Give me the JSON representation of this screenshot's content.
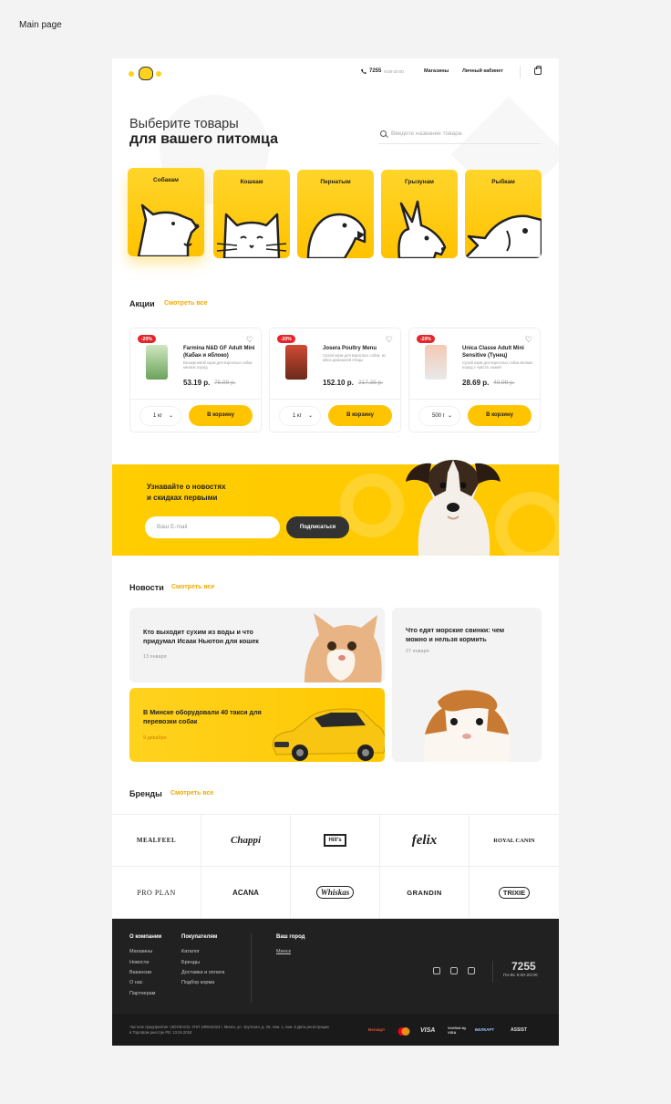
{
  "caption": "Main page",
  "header": {
    "phone": "7255",
    "hours": "9:00-20:00",
    "nav": [
      "Магазины",
      "Личный кабинет"
    ]
  },
  "hero": {
    "title_light": "Выберите товары",
    "title_bold": "для вашего питомца",
    "search_placeholder": "Введите название товара"
  },
  "categories": [
    "Собакам",
    "Кошкам",
    "Пернатым",
    "Грызунам",
    "Рыбкам"
  ],
  "promo": {
    "title": "Акции",
    "link": "Смотреть все",
    "products": [
      {
        "badge": "-20%",
        "name": "Farmina N&D GF Adult Mini (Кабан и яблоко)",
        "desc": "Беззерновой корм для взрослых собак мелких пород",
        "price": "53.19 р.",
        "old_price": "75.99 р.",
        "qty": "1 кг",
        "button": "В корзину"
      },
      {
        "badge": "-20%",
        "name": "Josera Poultry Menu",
        "desc": "Сухой корм для взрослых собак, из мяса домашней птицы",
        "price": "152.10 р.",
        "old_price": "217.35 р.",
        "qty": "1 кг",
        "button": "В корзину"
      },
      {
        "badge": "-20%",
        "name": "Unica Classe Adult Mini Sensitive (Тунец)",
        "desc": "Сухой корм для взрослых собак мелких пород с чувств. кожей",
        "price": "28.69 р.",
        "old_price": "40.99 р.",
        "qty": "500 г",
        "button": "В корзину"
      }
    ]
  },
  "newsletter": {
    "title_line1": "Узнавайте о новостях",
    "title_line2": "и скидках первыми",
    "email_placeholder": "Ваш E-mail",
    "button": "Подписаться"
  },
  "news": {
    "title": "Новости",
    "link": "Смотреть все",
    "items": [
      {
        "title": "Кто выходит сухим из воды и что придумал Исаак Ньютон для кошек",
        "date": "13 января"
      },
      {
        "title": "В Минске оборудовали 40 такси для перевозки собак",
        "date": "9 декабря"
      },
      {
        "title": "Что едят морские свинки: чем можно и нельзя кормить",
        "date": "27 января"
      }
    ]
  },
  "brands": {
    "title": "Бренды",
    "link": "Смотреть все",
    "logos": [
      "MEALFEEL",
      "Chappi",
      "Hill's",
      "felix",
      "ROYAL CANIN",
      "PRO PLAN",
      "ACANA",
      "Whiskas",
      "GRANDIN",
      "TRIXIE"
    ]
  },
  "footer": {
    "col1_title": "О компании",
    "col1_links": [
      "Магазины",
      "Новости",
      "Вакансии",
      "О нас",
      "Партнерам"
    ],
    "col2_title": "Покупателям",
    "col2_links": [
      "Каталог",
      "Бренды",
      "Доставка и оплата",
      "Подбор корма"
    ],
    "col3_title": "Ваш город",
    "city": "Минск",
    "phone": "7255",
    "hours": "Пн-Вс 9:00-20:00",
    "legal": "Частное предприятие «ЗООКАУЗ» УНП 190842323 г. Минск, ул. Уручская, д. 29, пом. 1, ком. 6 Дата регистрации в Торговом реестре РБ: 13.04.2018",
    "payments": [
      "Белкарт",
      "MasterCard",
      "VISA",
      "Verified by VISA",
      "БЕЛКАРТ",
      "ASSIST"
    ]
  },
  "colors": {
    "accent": "#ffc400",
    "link": "#f2a900",
    "dark": "#212121",
    "badge": "#e2262b"
  }
}
